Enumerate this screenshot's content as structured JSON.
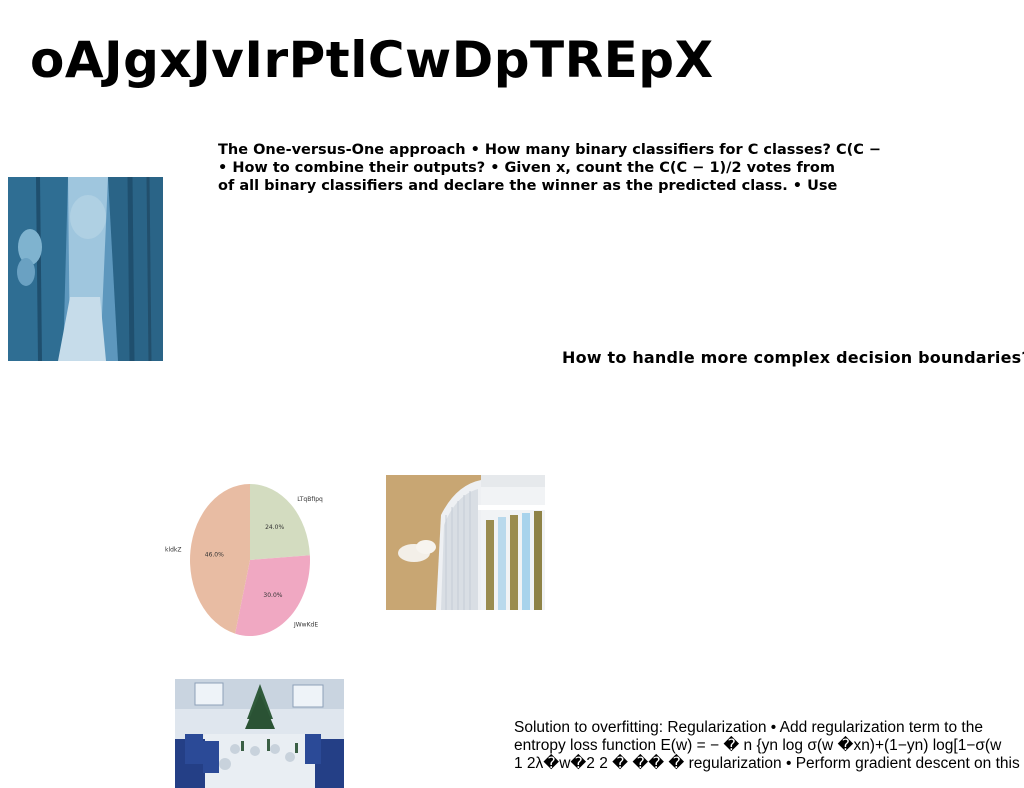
{
  "title": "oAJgxJvIrPtlCwDpTREpX",
  "bullets": [
    "The One-versus-One approach • How many binary classifiers for C classes? C(C −",
    "• How to combine their outputs? • Given x, count the C(C − 1)/2 votes from",
    "of all binary classifiers and declare the winner as the predicted class. • Use"
  ],
  "question": "How to handle more complex decision boundaries?",
  "bottom_text": [
    "Solution to overfitting: Regularization • Add regularization term to the",
    "entropy loss function E(w) = − � n {yn log σ(w �xn)+(1−yn) log[1−σ(w",
    "1 2λ�w�2 2 � �� � regularization • Perform gradient descent on this"
  ],
  "images": {
    "forest": "forest-photo",
    "building": "building-photo",
    "dining": "dining-room-photo"
  },
  "chart_data": {
    "type": "pie",
    "categories": [
      "LTqBfIpq",
      "JWwKdE",
      "kldkZ"
    ],
    "values": [
      24.0,
      30.0,
      46.0
    ],
    "labels": [
      "24.0%",
      "30.0%",
      "46.0%"
    ],
    "colors": [
      "#d3dcc0",
      "#f0a8c2",
      "#e8bca3"
    ],
    "start_angle_deg": 90,
    "direction": "clockwise",
    "title": ""
  }
}
